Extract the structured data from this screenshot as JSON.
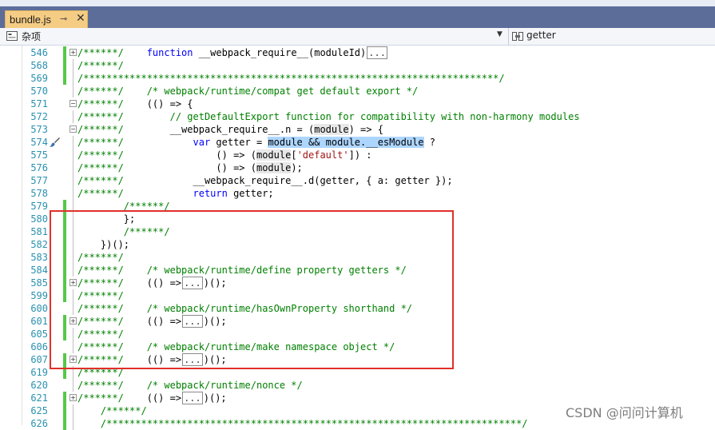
{
  "tab": {
    "title": "bundle.js",
    "pin_glyph": "⊸",
    "close_glyph": "✕"
  },
  "navbar": {
    "left_label": "杂项",
    "right_label": "getter"
  },
  "watermark": "CSDN @问问计算机",
  "lines": [
    {
      "n": "546",
      "fold": "+",
      "chg": true,
      "segs": [
        [
          "cm",
          "/******/    "
        ],
        [
          "kw",
          "function"
        ],
        [
          "t",
          " __webpack_require__(moduleId)"
        ],
        [
          "box",
          "..."
        ]
      ]
    },
    {
      "n": "568",
      "chg": true,
      "segs": [
        [
          "cm",
          "/******/"
        ]
      ]
    },
    {
      "n": "569",
      "chg": true,
      "segs": [
        [
          "cm",
          "/************************************************************************/"
        ]
      ]
    },
    {
      "n": "570",
      "segs": [
        [
          "cm",
          "/******/    /* webpack/runtime/compat get default export */"
        ]
      ]
    },
    {
      "n": "571",
      "fold": "-",
      "segs": [
        [
          "cm",
          "/******/    "
        ],
        [
          "t",
          "(() => {"
        ]
      ]
    },
    {
      "n": "572",
      "segs": [
        [
          "cm",
          "/******/        // getDefaultExport function for compatibility with non-harmony modules"
        ]
      ]
    },
    {
      "n": "573",
      "fold": "-",
      "segs": [
        [
          "cm",
          "/******/        "
        ],
        [
          "t",
          "__webpack_require__.n = ("
        ],
        [
          "ref",
          "module"
        ],
        [
          "t",
          ") => {"
        ]
      ]
    },
    {
      "n": "574",
      "brush": true,
      "segs": [
        [
          "cm",
          "/******/            "
        ],
        [
          "kw",
          "var"
        ],
        [
          "t",
          " getter = "
        ],
        [
          "hl",
          "module && module.__esModule"
        ],
        [
          "t",
          " ?"
        ]
      ]
    },
    {
      "n": "575",
      "segs": [
        [
          "cm",
          "/******/                "
        ],
        [
          "t",
          "() => ("
        ],
        [
          "ref",
          "module"
        ],
        [
          "t",
          "["
        ],
        [
          "str",
          "'default'"
        ],
        [
          "t",
          "]) :"
        ]
      ]
    },
    {
      "n": "576",
      "segs": [
        [
          "cm",
          "/******/                "
        ],
        [
          "t",
          "() => ("
        ],
        [
          "ref",
          "module"
        ],
        [
          "t",
          ");"
        ]
      ]
    },
    {
      "n": "577",
      "segs": [
        [
          "cm",
          "/******/            "
        ],
        [
          "t",
          "__webpack_require__.d(getter, { a: getter });"
        ]
      ]
    },
    {
      "n": "578",
      "segs": [
        [
          "cm",
          "/******/            "
        ],
        [
          "kw",
          "return"
        ],
        [
          "t",
          " getter;"
        ]
      ]
    },
    {
      "n": "579",
      "chg": true,
      "segs": [
        [
          "t",
          "        "
        ],
        [
          "cm",
          "/******/"
        ]
      ]
    },
    {
      "n": "580",
      "chg": true,
      "segs": [
        [
          "t",
          "        };"
        ]
      ]
    },
    {
      "n": "581",
      "chg": true,
      "segs": [
        [
          "t",
          "        "
        ],
        [
          "cm",
          "/******/"
        ]
      ]
    },
    {
      "n": "582",
      "chg": true,
      "segs": [
        [
          "t",
          "    })();"
        ]
      ]
    },
    {
      "n": "583",
      "chg": true,
      "segs": [
        [
          "cm",
          "/******/"
        ]
      ]
    },
    {
      "n": "584",
      "chg": true,
      "segs": [
        [
          "cm",
          "/******/    /* webpack/runtime/define property getters */"
        ]
      ]
    },
    {
      "n": "585",
      "fold": "+",
      "chg": true,
      "segs": [
        [
          "cm",
          "/******/    "
        ],
        [
          "t",
          "(() =>"
        ],
        [
          "box",
          "..."
        ],
        [
          "t",
          ")();"
        ]
      ]
    },
    {
      "n": "599",
      "chg": true,
      "segs": [
        [
          "cm",
          "/******/"
        ]
      ]
    },
    {
      "n": "600",
      "segs": [
        [
          "cm",
          "/******/    /* webpack/runtime/hasOwnProperty shorthand */"
        ]
      ]
    },
    {
      "n": "601",
      "fold": "+",
      "chg": true,
      "segs": [
        [
          "cm",
          "/******/    "
        ],
        [
          "t",
          "(() =>"
        ],
        [
          "box",
          "..."
        ],
        [
          "t",
          ")();"
        ]
      ]
    },
    {
      "n": "605",
      "chg": true,
      "segs": [
        [
          "cm",
          "/******/"
        ]
      ]
    },
    {
      "n": "606",
      "segs": [
        [
          "cm",
          "/******/    /* webpack/runtime/make namespace object */"
        ]
      ]
    },
    {
      "n": "607",
      "fold": "+",
      "chg": true,
      "segs": [
        [
          "cm",
          "/******/    "
        ],
        [
          "t",
          "(() =>"
        ],
        [
          "box",
          "..."
        ],
        [
          "t",
          ")();"
        ]
      ]
    },
    {
      "n": "619",
      "chg": true,
      "segs": [
        [
          "cm",
          "/******/"
        ]
      ]
    },
    {
      "n": "620",
      "segs": [
        [
          "cm",
          "/******/    /* webpack/runtime/nonce */"
        ]
      ]
    },
    {
      "n": "621",
      "fold": "+",
      "chg": true,
      "segs": [
        [
          "cm",
          "/******/    "
        ],
        [
          "t",
          "(() =>"
        ],
        [
          "box",
          "..."
        ],
        [
          "t",
          ")();"
        ]
      ]
    },
    {
      "n": "625",
      "chg": true,
      "segs": [
        [
          "t",
          "    "
        ],
        [
          "cm",
          "/******/"
        ]
      ]
    },
    {
      "n": "626",
      "chg": true,
      "segs": [
        [
          "t",
          "    "
        ],
        [
          "cm",
          "/************************************************************************/"
        ]
      ]
    }
  ]
}
